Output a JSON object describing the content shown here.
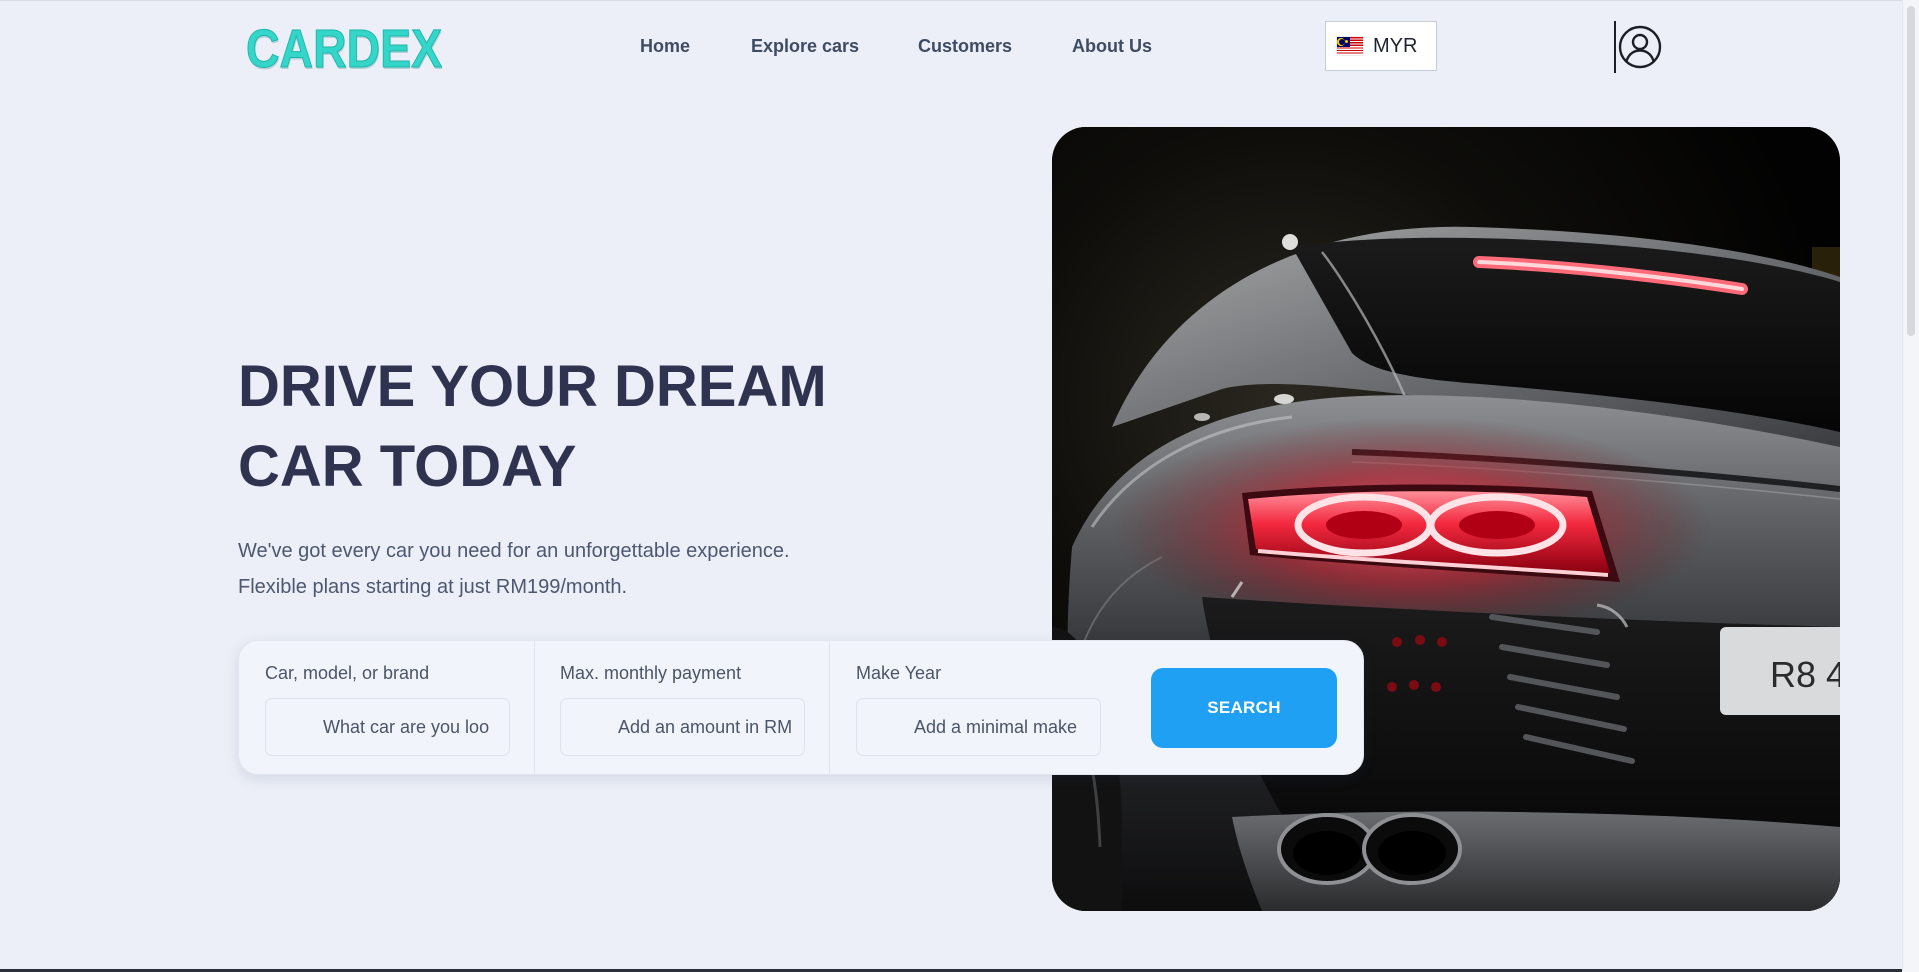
{
  "header": {
    "logo": "CARDEX",
    "nav": [
      {
        "label": "Home"
      },
      {
        "label": "Explore cars"
      },
      {
        "label": "Customers"
      },
      {
        "label": "About Us"
      }
    ],
    "currency": {
      "code": "MYR",
      "flag_icon": "malaysia-flag-icon"
    },
    "profile_icon": "user-circle-icon"
  },
  "hero": {
    "headline_line1": "DRIVE YOUR DREAM",
    "headline_line2": "CAR TODAY",
    "subtext_line1": "We've got every car you need for an unforgettable experience.",
    "subtext_line2": "Flexible plans starting at just RM199/month.",
    "image_plate_text": "R8 4"
  },
  "search": {
    "fields": [
      {
        "label": "Car, model, or brand",
        "placeholder": "What car are you loo"
      },
      {
        "label": "Max. monthly payment",
        "placeholder": "Add an amount in RM"
      },
      {
        "label": "Make Year",
        "placeholder": "Add a minimal make"
      }
    ],
    "button_label": "SEARCH"
  },
  "colors": {
    "page_background": "#eceff7",
    "logo": "#33d6c8",
    "headline": "#2f3350",
    "nav_text": "#3e4c63",
    "search_button": "#20a0f2"
  }
}
